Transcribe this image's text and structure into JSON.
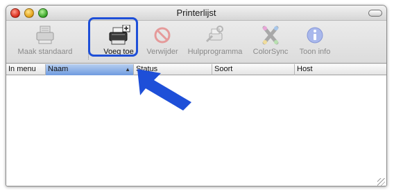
{
  "window": {
    "title": "Printerlijst"
  },
  "toolbar": {
    "items": [
      {
        "label": "Maak standaard",
        "icon": "printer-default-icon",
        "enabled": false
      },
      {
        "label": "Voeg toe",
        "icon": "add-printer-icon",
        "enabled": true
      },
      {
        "label": "Verwijder",
        "icon": "delete-printer-icon",
        "enabled": false
      },
      {
        "label": "Hulpprogramma",
        "icon": "utility-icon",
        "enabled": false
      },
      {
        "label": "ColorSync",
        "icon": "colorsync-icon",
        "enabled": false
      },
      {
        "label": "Toon info",
        "icon": "info-icon",
        "enabled": false
      }
    ]
  },
  "table": {
    "columns": [
      {
        "label": "In menu"
      },
      {
        "label": "Naam",
        "sorted": true
      },
      {
        "label": "Status"
      },
      {
        "label": "Soort"
      },
      {
        "label": "Host"
      }
    ],
    "rows": []
  },
  "annotation": {
    "color": "#1e4fd8"
  }
}
